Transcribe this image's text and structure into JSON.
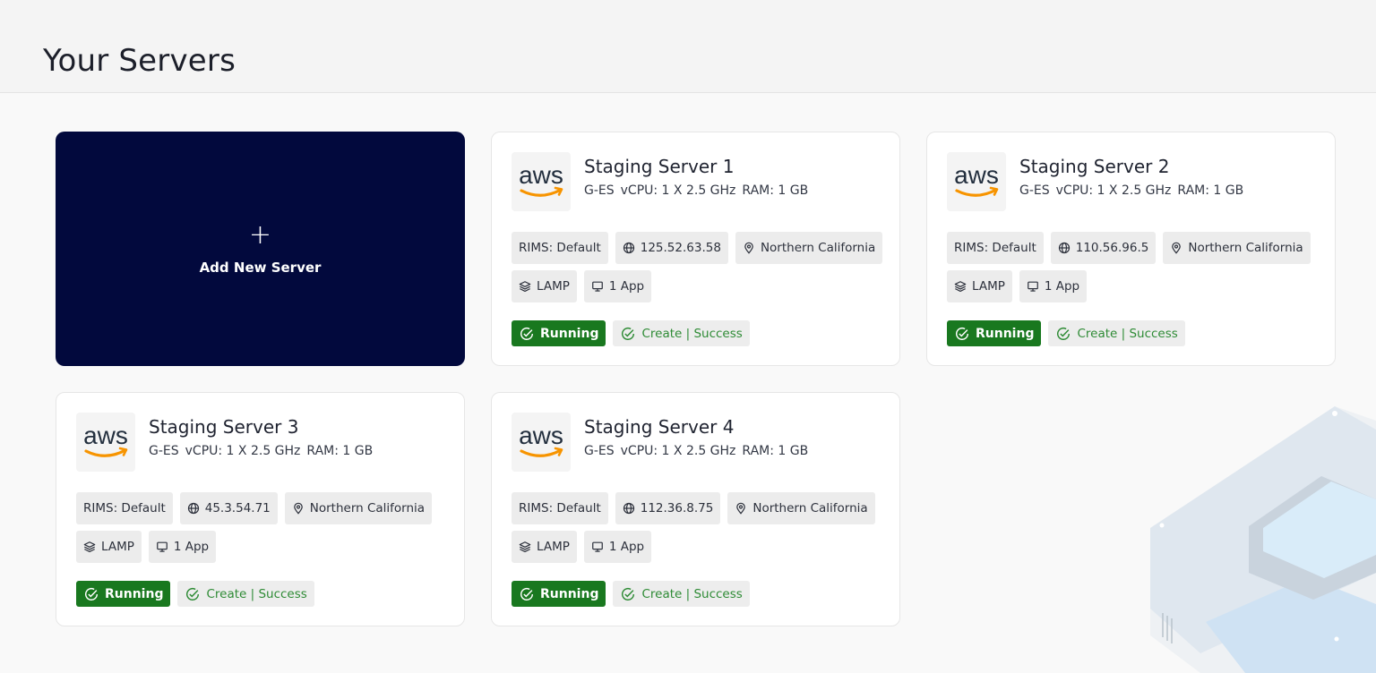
{
  "page": {
    "title": "Your Servers"
  },
  "add_card": {
    "plus": "+",
    "label": "Add New Server"
  },
  "servers": [
    {
      "logo_text": "aws",
      "name": "Staging Server 1",
      "plan": "G-ES",
      "vcpu": "vCPU: 1 X 2.5 GHz",
      "ram": "RAM: 1 GB",
      "rims": "RIMS: Default",
      "ip": "125.52.63.58",
      "location": "Northern California",
      "stack": "LAMP",
      "apps": "1 App",
      "status": "Running",
      "operation": "Create | Success"
    },
    {
      "logo_text": "aws",
      "name": "Staging Server 2",
      "plan": "G-ES",
      "vcpu": "vCPU: 1 X 2.5 GHz",
      "ram": "RAM: 1 GB",
      "rims": "RIMS: Default",
      "ip": "110.56.96.5",
      "location": "Northern California",
      "stack": "LAMP",
      "apps": "1 App",
      "status": "Running",
      "operation": "Create | Success"
    },
    {
      "logo_text": "aws",
      "name": "Staging Server 3",
      "plan": "G-ES",
      "vcpu": "vCPU: 1 X 2.5 GHz",
      "ram": "RAM: 1 GB",
      "rims": "RIMS: Default",
      "ip": "45.3.54.71",
      "location": "Northern California",
      "stack": "LAMP",
      "apps": "1 App",
      "status": "Running",
      "operation": "Create | Success"
    },
    {
      "logo_text": "aws",
      "name": "Staging Server 4",
      "plan": "G-ES",
      "vcpu": "vCPU: 1 X 2.5 GHz",
      "ram": "RAM: 1 GB",
      "rims": "RIMS: Default",
      "ip": "112.36.8.75",
      "location": "Northern California",
      "stack": "LAMP",
      "apps": "1 App",
      "status": "Running",
      "operation": "Create | Success"
    }
  ],
  "colors": {
    "add_card_bg": "#02093d",
    "running_bg": "#19781f",
    "success_text": "#2e8b35",
    "aws_orange": "#f79400",
    "aws_text": "#232f3e"
  },
  "icons": {
    "ip": "globe-icon",
    "location": "map-pin-icon",
    "stack": "layers-icon",
    "apps": "monitor-icon",
    "status": "check-circle-icon"
  }
}
